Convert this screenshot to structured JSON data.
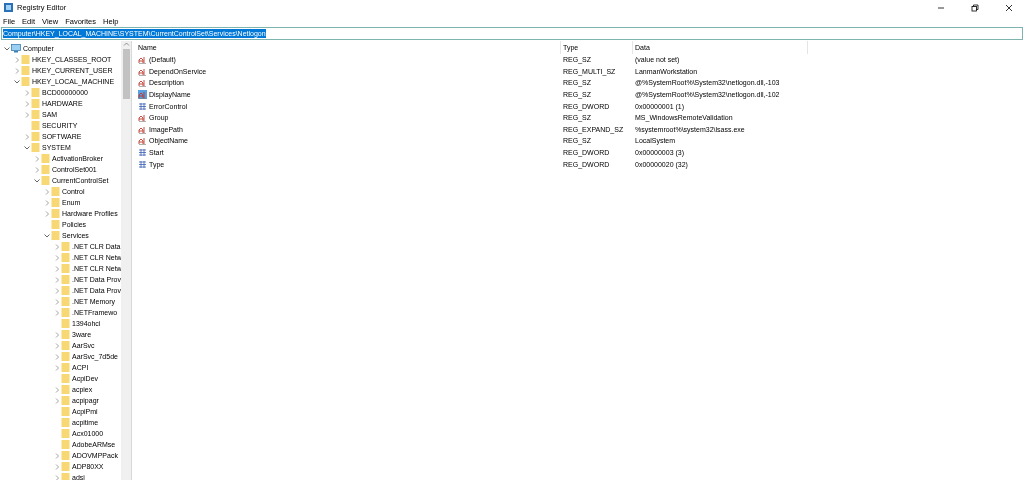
{
  "window": {
    "title": "Registry Editor"
  },
  "menu": [
    "File",
    "Edit",
    "View",
    "Favorites",
    "Help"
  ],
  "address": {
    "value": "Computer\\HKEY_LOCAL_MACHINE\\SYSTEM\\CurrentControlSet\\Services\\Netlogon",
    "selected": true
  },
  "tree": [
    {
      "label": "Computer",
      "kind": "computer",
      "expanded": true,
      "children": [
        {
          "label": "HKEY_CLASSES_ROOT",
          "kind": "branch",
          "expanded": false
        },
        {
          "label": "HKEY_CURRENT_USER",
          "kind": "branch",
          "expanded": false
        },
        {
          "label": "HKEY_LOCAL_MACHINE",
          "kind": "branch",
          "expanded": true,
          "children": [
            {
              "label": "BCD00000000",
              "kind": "branch",
              "expanded": false
            },
            {
              "label": "HARDWARE",
              "kind": "branch",
              "expanded": false
            },
            {
              "label": "SAM",
              "kind": "branch",
              "expanded": false
            },
            {
              "label": "SECURITY",
              "kind": "leaf"
            },
            {
              "label": "SOFTWARE",
              "kind": "branch",
              "expanded": false
            },
            {
              "label": "SYSTEM",
              "kind": "branch",
              "expanded": true,
              "children": [
                {
                  "label": "ActivationBroker",
                  "kind": "branch",
                  "expanded": false
                },
                {
                  "label": "ControlSet001",
                  "kind": "branch",
                  "expanded": false
                },
                {
                  "label": "CurrentControlSet",
                  "kind": "branch",
                  "expanded": true,
                  "children": [
                    {
                      "label": "Control",
                      "kind": "branch",
                      "expanded": false
                    },
                    {
                      "label": "Enum",
                      "kind": "branch",
                      "expanded": false
                    },
                    {
                      "label": "Hardware Profiles",
                      "kind": "branch",
                      "expanded": false
                    },
                    {
                      "label": "Policies",
                      "kind": "leaf"
                    },
                    {
                      "label": "Services",
                      "kind": "branch",
                      "expanded": true,
                      "children": [
                        {
                          "label": ".NET CLR Data",
                          "kind": "branch",
                          "expanded": false
                        },
                        {
                          "label": ".NET CLR Netw",
                          "kind": "branch",
                          "expanded": false
                        },
                        {
                          "label": ".NET CLR Netw",
                          "kind": "branch",
                          "expanded": false
                        },
                        {
                          "label": ".NET Data Prov",
                          "kind": "branch",
                          "expanded": false
                        },
                        {
                          "label": ".NET Data Prov",
                          "kind": "branch",
                          "expanded": false
                        },
                        {
                          "label": ".NET Memory",
                          "kind": "branch",
                          "expanded": false
                        },
                        {
                          "label": ".NETFramewo",
                          "kind": "branch",
                          "expanded": false
                        },
                        {
                          "label": "1394ohci",
                          "kind": "leaf"
                        },
                        {
                          "label": "3ware",
                          "kind": "branch",
                          "expanded": false
                        },
                        {
                          "label": "AarSvc",
                          "kind": "branch",
                          "expanded": false
                        },
                        {
                          "label": "AarSvc_7d5de",
                          "kind": "branch",
                          "expanded": false
                        },
                        {
                          "label": "ACPI",
                          "kind": "branch",
                          "expanded": false
                        },
                        {
                          "label": "AcpiDev",
                          "kind": "leaf"
                        },
                        {
                          "label": "acpiex",
                          "kind": "branch",
                          "expanded": false
                        },
                        {
                          "label": "acpipagr",
                          "kind": "branch",
                          "expanded": false
                        },
                        {
                          "label": "AcpiPmi",
                          "kind": "leaf"
                        },
                        {
                          "label": "acpitime",
                          "kind": "leaf"
                        },
                        {
                          "label": "Acx01000",
                          "kind": "leaf"
                        },
                        {
                          "label": "AdobeARMse",
                          "kind": "leaf"
                        },
                        {
                          "label": "ADOVMPPack",
                          "kind": "branch",
                          "expanded": false
                        },
                        {
                          "label": "ADP80XX",
                          "kind": "branch",
                          "expanded": false
                        },
                        {
                          "label": "adsi",
                          "kind": "branch",
                          "expanded": false
                        }
                      ]
                    }
                  ]
                }
              ]
            }
          ]
        }
      ]
    }
  ],
  "values": {
    "columns": [
      "Name",
      "Type",
      "Data"
    ],
    "rows": [
      {
        "name": "(Default)",
        "kind": "string",
        "type": "REG_SZ",
        "data": "(value not set)",
        "selected": false
      },
      {
        "name": "DependOnService",
        "kind": "string",
        "type": "REG_MULTI_SZ",
        "data": "LanmanWorkstation",
        "selected": false
      },
      {
        "name": "Description",
        "kind": "string",
        "type": "REG_SZ",
        "data": "@%SystemRoot%\\System32\\netlogon.dll,-103",
        "selected": false
      },
      {
        "name": "DisplayName",
        "kind": "string",
        "type": "REG_SZ",
        "data": "@%SystemRoot%\\System32\\netlogon.dll,-102",
        "selected": true
      },
      {
        "name": "ErrorControl",
        "kind": "binary",
        "type": "REG_DWORD",
        "data": "0x00000001 (1)",
        "selected": false
      },
      {
        "name": "Group",
        "kind": "string",
        "type": "REG_SZ",
        "data": "MS_WindowsRemoteValidation",
        "selected": false
      },
      {
        "name": "ImagePath",
        "kind": "string",
        "type": "REG_EXPAND_SZ",
        "data": "%systemroot%\\system32\\lsass.exe",
        "selected": false
      },
      {
        "name": "ObjectName",
        "kind": "string",
        "type": "REG_SZ",
        "data": "LocalSystem",
        "selected": false
      },
      {
        "name": "Start",
        "kind": "binary",
        "type": "REG_DWORD",
        "data": "0x00000003 (3)",
        "selected": false
      },
      {
        "name": "Type",
        "kind": "binary",
        "type": "REG_DWORD",
        "data": "0x00000020 (32)",
        "selected": false
      }
    ]
  }
}
